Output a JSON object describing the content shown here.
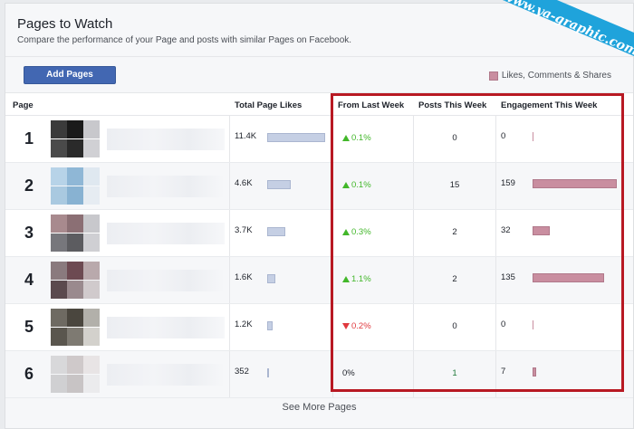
{
  "header": {
    "title": "Pages to Watch",
    "subtitle": "Compare the performance of your Page and posts with similar Pages on Facebook."
  },
  "toolbar": {
    "add_pages_label": "Add Pages",
    "legend_label": "Likes, Comments & Shares"
  },
  "columns": {
    "page": "Page",
    "total_likes": "Total Page Likes",
    "from_last_week": "From Last Week",
    "posts": "Posts This Week",
    "engagement": "Engagement This Week"
  },
  "rows": [
    {
      "rank": "1",
      "likes": "11.4K",
      "likes_fraction": 1.0,
      "change": "0.1%",
      "trend": "up",
      "posts": "0",
      "posts_color": "#1d2129",
      "engagement": "0",
      "engagement_fraction": 0.0
    },
    {
      "rank": "2",
      "likes": "4.6K",
      "likes_fraction": 0.4,
      "change": "0.1%",
      "trend": "up",
      "posts": "15",
      "posts_color": "#1d2129",
      "engagement": "159",
      "engagement_fraction": 1.0
    },
    {
      "rank": "3",
      "likes": "3.7K",
      "likes_fraction": 0.32,
      "change": "0.3%",
      "trend": "up",
      "posts": "2",
      "posts_color": "#1d2129",
      "engagement": "32",
      "engagement_fraction": 0.2
    },
    {
      "rank": "4",
      "likes": "1.6K",
      "likes_fraction": 0.14,
      "change": "1.1%",
      "trend": "up",
      "posts": "2",
      "posts_color": "#1d2129",
      "engagement": "135",
      "engagement_fraction": 0.85
    },
    {
      "rank": "5",
      "likes": "1.2K",
      "likes_fraction": 0.1,
      "change": "0.2%",
      "trend": "down",
      "posts": "0",
      "posts_color": "#1d2129",
      "engagement": "0",
      "engagement_fraction": 0.0
    },
    {
      "rank": "6",
      "likes": "352",
      "likes_fraction": 0.03,
      "change": "0%",
      "trend": "none",
      "posts": "1",
      "posts_color": "#1f7a3a",
      "engagement": "7",
      "engagement_fraction": 0.04
    }
  ],
  "footer": {
    "see_more_label": "See More Pages"
  },
  "watermark": "www.ya-graphic.com",
  "colors": {
    "likes_bar": "#c5cfe4",
    "engagement_bar": "#c98ea0",
    "highlight_box": "#b81923",
    "up": "#42b72a",
    "down": "#e0393e",
    "button": "#4267b2",
    "banner": "#1fa3db"
  },
  "icons": {
    "up": "triangle-up-icon",
    "down": "triangle-down-icon"
  }
}
